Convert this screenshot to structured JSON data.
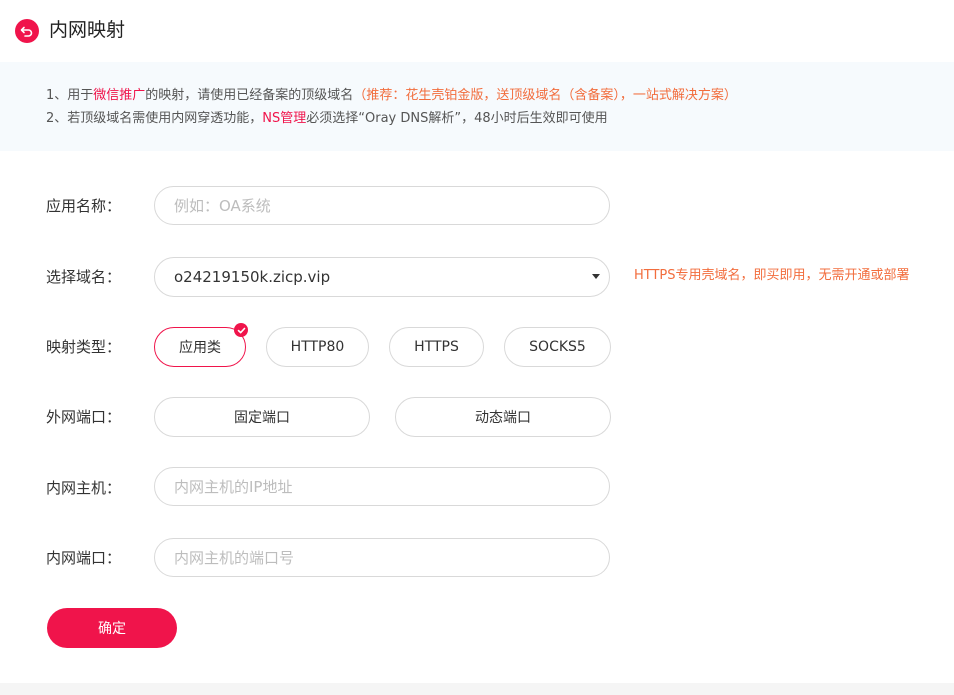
{
  "header": {
    "title": "内网映射",
    "back_icon": "back-arrow-icon",
    "accent_color": "#f0144b"
  },
  "notice": {
    "line1": {
      "prefix": "1、用于",
      "highlight": "微信推广",
      "middle": "的映射，请使用已经备案的顶级域名",
      "recommend": "（推荐：花生壳铂金版，送顶级域名（含备案），一站式解决方案）"
    },
    "line2": {
      "prefix": "2、若顶级域名需使用内网穿透功能，",
      "highlight": "NS管理",
      "suffix": "必须选择“Oray DNS解析”，48小时后生效即可使用"
    }
  },
  "form": {
    "app_name": {
      "label": "应用名称：",
      "placeholder": "例如：OA系统",
      "value": ""
    },
    "domain": {
      "label": "选择域名：",
      "selected": "o24219150k.zicp.vip",
      "hint": "HTTPS专用壳域名，即买即用，无需开通或部署"
    },
    "mapping_type": {
      "label": "映射类型：",
      "options": [
        "应用类",
        "HTTP80",
        "HTTPS",
        "SOCKS5"
      ],
      "selected": "应用类"
    },
    "external_port": {
      "label": "外网端口：",
      "options": [
        "固定端口",
        "动态端口"
      ]
    },
    "internal_host": {
      "label": "内网主机：",
      "placeholder": "内网主机的IP地址",
      "value": ""
    },
    "internal_port": {
      "label": "内网端口：",
      "placeholder": "内网主机的端口号",
      "value": ""
    },
    "submit_label": "确定"
  }
}
